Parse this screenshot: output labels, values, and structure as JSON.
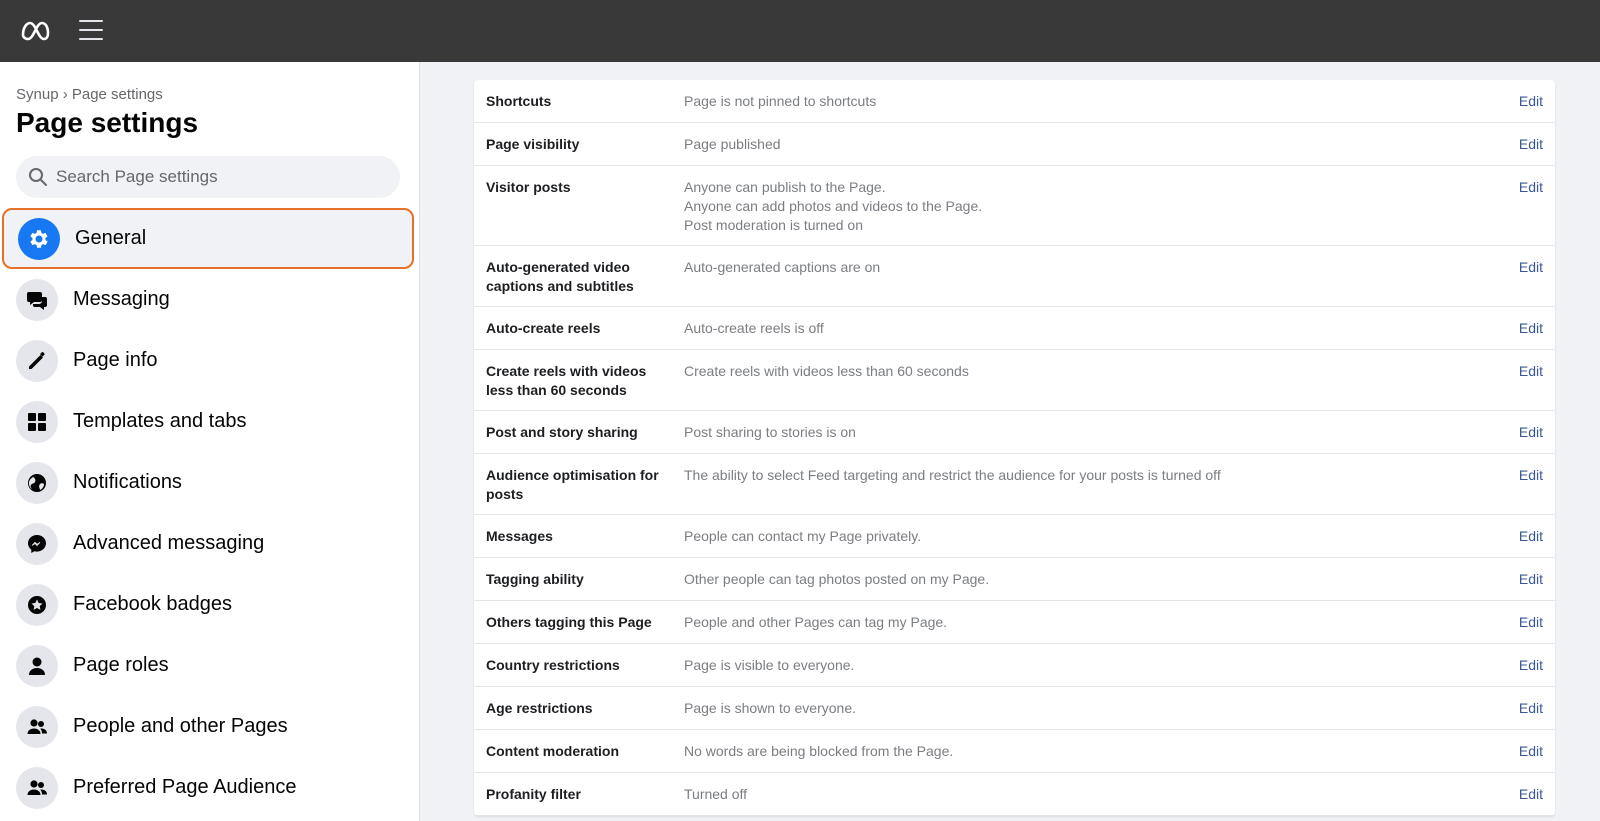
{
  "topbar": {
    "logo_icon": "meta-logo-icon",
    "menu_icon": "hamburger-menu-icon"
  },
  "sidebar": {
    "breadcrumb": "Synup › Page settings",
    "title": "Page settings",
    "search_placeholder": "Search Page settings",
    "items": [
      {
        "label": "General",
        "icon": "gear-icon",
        "active": true
      },
      {
        "label": "Messaging",
        "icon": "chat-bubbles-icon"
      },
      {
        "label": "Page info",
        "icon": "pencil-icon"
      },
      {
        "label": "Templates and tabs",
        "icon": "grid-icon"
      },
      {
        "label": "Notifications",
        "icon": "globe-icon"
      },
      {
        "label": "Advanced messaging",
        "icon": "messenger-icon"
      },
      {
        "label": "Facebook badges",
        "icon": "star-badge-icon"
      },
      {
        "label": "Page roles",
        "icon": "person-icon"
      },
      {
        "label": "People and other Pages",
        "icon": "people-icon"
      },
      {
        "label": "Preferred Page Audience",
        "icon": "people-icon"
      }
    ]
  },
  "settings": {
    "edit_label": "Edit",
    "rows": [
      {
        "label": "Shortcuts",
        "values": [
          "Page is not pinned to shortcuts"
        ]
      },
      {
        "label": "Page visibility",
        "values": [
          "Page published"
        ]
      },
      {
        "label": "Visitor posts",
        "values": [
          "Anyone can publish to the Page.",
          "Anyone can add photos and videos to the Page.",
          "Post moderation is turned on"
        ]
      },
      {
        "label": "Auto-generated video captions and subtitles",
        "values": [
          "Auto-generated captions are on"
        ]
      },
      {
        "label": "Auto-create reels",
        "values": [
          "Auto-create reels is off"
        ]
      },
      {
        "label": "Create reels with videos less than 60 seconds",
        "values": [
          "Create reels with videos less than 60 seconds"
        ]
      },
      {
        "label": "Post and story sharing",
        "values": [
          "Post sharing to stories is on"
        ]
      },
      {
        "label": "Audience optimisation for posts",
        "values": [
          "The ability to select Feed targeting and restrict the audience for your posts is turned off"
        ]
      },
      {
        "label": "Messages",
        "values": [
          "People can contact my Page privately."
        ]
      },
      {
        "label": "Tagging ability",
        "values": [
          "Other people can tag photos posted on my Page."
        ]
      },
      {
        "label": "Others tagging this Page",
        "values": [
          "People and other Pages can tag my Page."
        ]
      },
      {
        "label": "Country restrictions",
        "values": [
          "Page is visible to everyone."
        ]
      },
      {
        "label": "Age restrictions",
        "values": [
          "Page is shown to everyone."
        ]
      },
      {
        "label": "Content moderation",
        "values": [
          "No words are being blocked from the Page."
        ]
      },
      {
        "label": "Profanity filter",
        "values": [
          "Turned off"
        ]
      }
    ]
  },
  "colors": {
    "accent": "#1877f2",
    "highlight_border": "#e8712a",
    "edit_link": "#385898",
    "topbar": "#393939"
  }
}
